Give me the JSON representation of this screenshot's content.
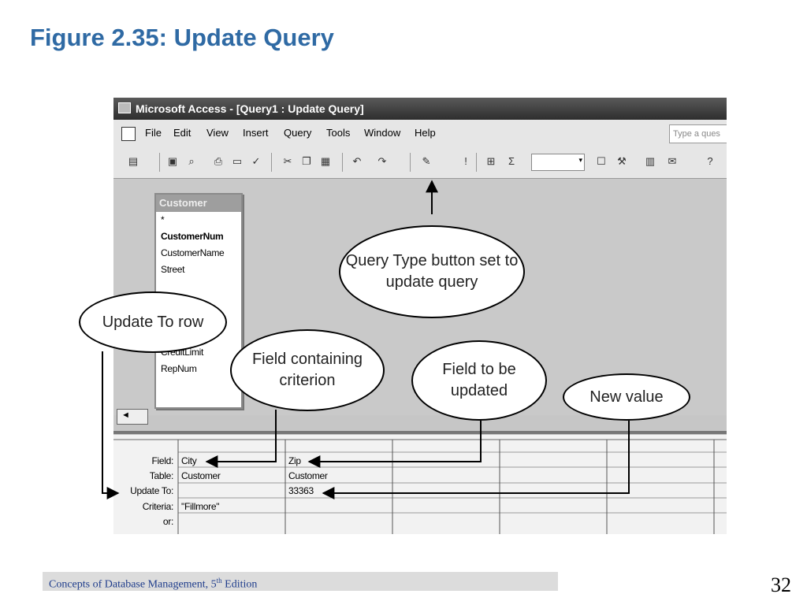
{
  "slide": {
    "title": "Figure 2.35: Update Query",
    "footer": "Concepts of Database Management, 5",
    "footer_sup": "th",
    "footer_suffix": " Edition",
    "page_number": "32"
  },
  "window": {
    "title": "Microsoft Access - [Query1 : Update Query]",
    "menus": [
      "File",
      "Edit",
      "View",
      "Insert",
      "Query",
      "Tools",
      "Window",
      "Help"
    ],
    "help_placeholder": "Type a ques"
  },
  "field_list": {
    "title": "Customer",
    "items": [
      "*",
      "CustomerNum",
      "CustomerName",
      "Street"
    ],
    "items_bottom": [
      "CreditLimit",
      "RepNum"
    ]
  },
  "grid": {
    "row_labels": [
      "Field:",
      "Table:",
      "Update To:",
      "Criteria:",
      "or:"
    ],
    "columns": [
      {
        "field": "City",
        "table": "Customer",
        "update_to": "",
        "criteria": "\"Fillmore\""
      },
      {
        "field": "Zip",
        "table": "Customer",
        "update_to": "33363",
        "criteria": ""
      }
    ]
  },
  "callouts": {
    "query_type": "Query Type button set to update query",
    "update_to_row": "Update To row",
    "field_criterion": "Field containing criterion",
    "field_updated": "Field to be updated",
    "new_value": "New value"
  },
  "icons": [
    "document-icon",
    "save-icon",
    "print-icon",
    "cut-icon",
    "copy-icon",
    "paste-icon",
    "undo-icon",
    "redo-icon",
    "query-type-icon",
    "run-icon",
    "show-table-icon",
    "totals-icon",
    "properties-icon",
    "build-icon",
    "database-window-icon",
    "new-object-icon",
    "help-icon"
  ]
}
